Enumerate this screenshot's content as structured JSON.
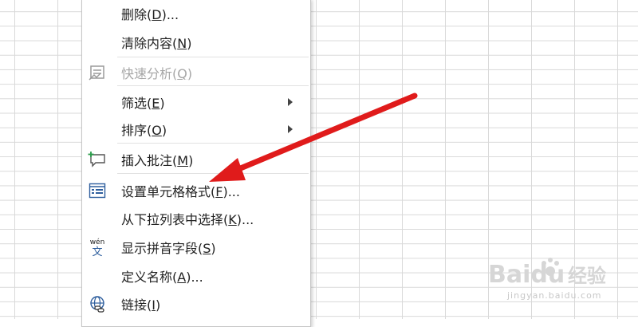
{
  "context_menu": {
    "items": [
      {
        "text": "删除(",
        "key": "D",
        "suffix": ")...",
        "disabled": false,
        "submenu": false,
        "icon": ""
      },
      {
        "text": "清除内容(",
        "key": "N",
        "suffix": ")",
        "disabled": false,
        "submenu": false,
        "icon": ""
      },
      {
        "text": "快速分析(",
        "key": "Q",
        "suffix": ")",
        "disabled": true,
        "submenu": false,
        "icon": "quick-analysis-icon"
      },
      {
        "text": "筛选(",
        "key": "E",
        "suffix": ")",
        "disabled": false,
        "submenu": true,
        "icon": ""
      },
      {
        "text": "排序(",
        "key": "O",
        "suffix": ")",
        "disabled": false,
        "submenu": true,
        "icon": ""
      },
      {
        "text": "插入批注(",
        "key": "M",
        "suffix": ")",
        "disabled": false,
        "submenu": false,
        "icon": "insert-comment-icon"
      },
      {
        "text": "设置单元格格式(",
        "key": "F",
        "suffix": ")...",
        "disabled": false,
        "submenu": false,
        "icon": "format-cells-icon"
      },
      {
        "text": "从下拉列表中选择(",
        "key": "K",
        "suffix": ")...",
        "disabled": false,
        "submenu": false,
        "icon": ""
      },
      {
        "text": "显示拼音字段(",
        "key": "S",
        "suffix": ")",
        "disabled": false,
        "submenu": false,
        "icon": "phonetic-guide-icon"
      },
      {
        "text": "定义名称(",
        "key": "A",
        "suffix": ")...",
        "disabled": false,
        "submenu": false,
        "icon": ""
      },
      {
        "text": "链接(",
        "key": "I",
        "suffix": ")",
        "disabled": false,
        "submenu": false,
        "icon": "link-icon"
      }
    ],
    "phonetic_icon_text": {
      "top": "wén",
      "bottom": "文"
    }
  },
  "watermark": {
    "brand": "Baidu",
    "product": "经验",
    "url": "jingyan.baidu.com"
  },
  "colors": {
    "annotation_arrow": "#e01b1b",
    "disabled_text": "#a6a6a6",
    "icon_blue": "#2f5f9e"
  }
}
